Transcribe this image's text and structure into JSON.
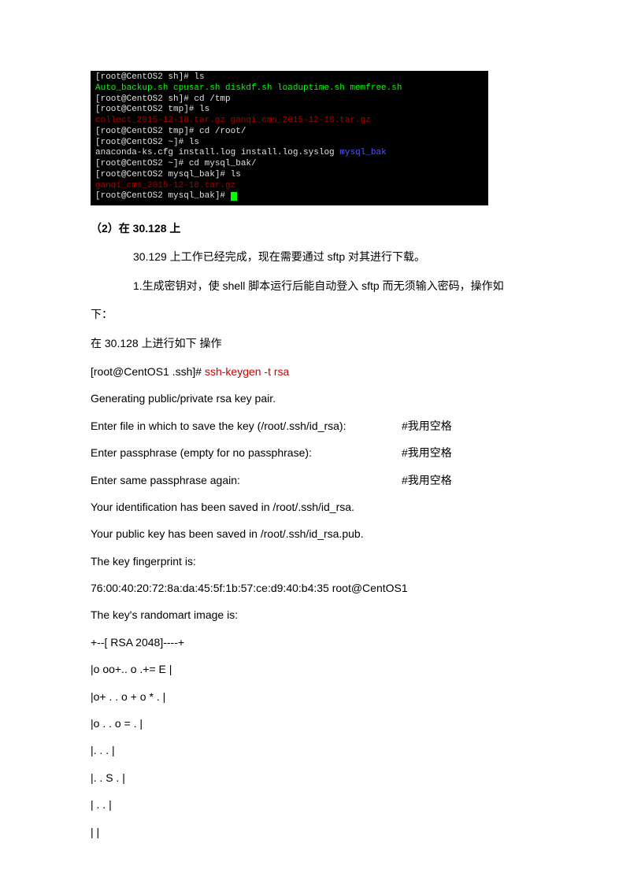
{
  "terminal": {
    "lines": [
      [
        {
          "cls": "tw",
          "t": "[root@CentOS2 sh]# ls"
        }
      ],
      [
        {
          "cls": "tg",
          "t": "Auto_backup.sh  cpusar.sh  diskdf.sh  loaduptime.sh  memfree.sh"
        }
      ],
      [
        {
          "cls": "tw",
          "t": "[root@CentOS2 sh]# cd /tmp"
        }
      ],
      [
        {
          "cls": "tw",
          "t": "[root@CentOS2 tmp]# ls"
        }
      ],
      [
        {
          "cls": "tr",
          "t": "collect_2015-12-18.tar.gz  ganqi_cms_2015-12-18.tar.gz"
        }
      ],
      [
        {
          "cls": "tw",
          "t": "[root@CentOS2 tmp]# cd /root/"
        }
      ],
      [
        {
          "cls": "tw",
          "t": "[root@CentOS2 ~]# ls"
        }
      ],
      [
        {
          "cls": "tw",
          "t": "anaconda-ks.cfg  install.log  install.log.syslog  "
        },
        {
          "cls": "tb",
          "t": "mysql_bak"
        }
      ],
      [
        {
          "cls": "tw",
          "t": "[root@CentOS2 ~]# cd mysql_bak/"
        }
      ],
      [
        {
          "cls": "tw",
          "t": "[root@CentOS2 mysql_bak]# ls"
        }
      ],
      [
        {
          "cls": "tr",
          "t": "ganqi_cms_2015-12-18.tar.gz"
        }
      ],
      [
        {
          "cls": "tw",
          "t": "[root@CentOS2 mysql_bak]# "
        },
        {
          "cls": "cursor",
          "t": ""
        }
      ]
    ]
  },
  "heading": "（2）在 30.128 上",
  "p1": "30.129 上工作已经完成，现在需要通过 sftp 对其进行下载。",
  "p2a": "1.生成密钥对，使 shell 脚本运行后能自动登入 sftp 而无须输入密码，操作如",
  "p2b": "下：",
  "p3": "在 30.128 上进行如下 操作",
  "prompt": "[root@CentOS1 .ssh]# ",
  "cmd": "ssh-keygen -t rsa",
  "out1": "Generating public/private rsa key pair.",
  "row1": {
    "l": "Enter file in which to save the key (/root/.ssh/id_rsa):",
    "r": "#我用空格"
  },
  "row2": {
    "l": "Enter passphrase (empty for no passphrase):",
    "r": "#我用空格"
  },
  "row3": {
    "l": "Enter same passphrase again:",
    "r": "#我用空格"
  },
  "out2": "Your identification has been saved in /root/.ssh/id_rsa.",
  "out3": "Your public key has been saved in /root/.ssh/id_rsa.pub.",
  "out4": "The key fingerprint is:",
  "out5": "76:00:40:20:72:8a:da:45:5f:1b:57:ce:d9:40:b4:35 root@CentOS1",
  "out6": "The key's randomart image is:",
  "art": [
    "+--[ RSA 2048]----+",
    "|o oo+.. o .+= E  |",
    "|o+ . . o + o * . |",
    "|o  . . o   = .  |",
    "|. .    .       |",
    "|. .    S .     |",
    "|    . .      |",
    "|            |"
  ]
}
